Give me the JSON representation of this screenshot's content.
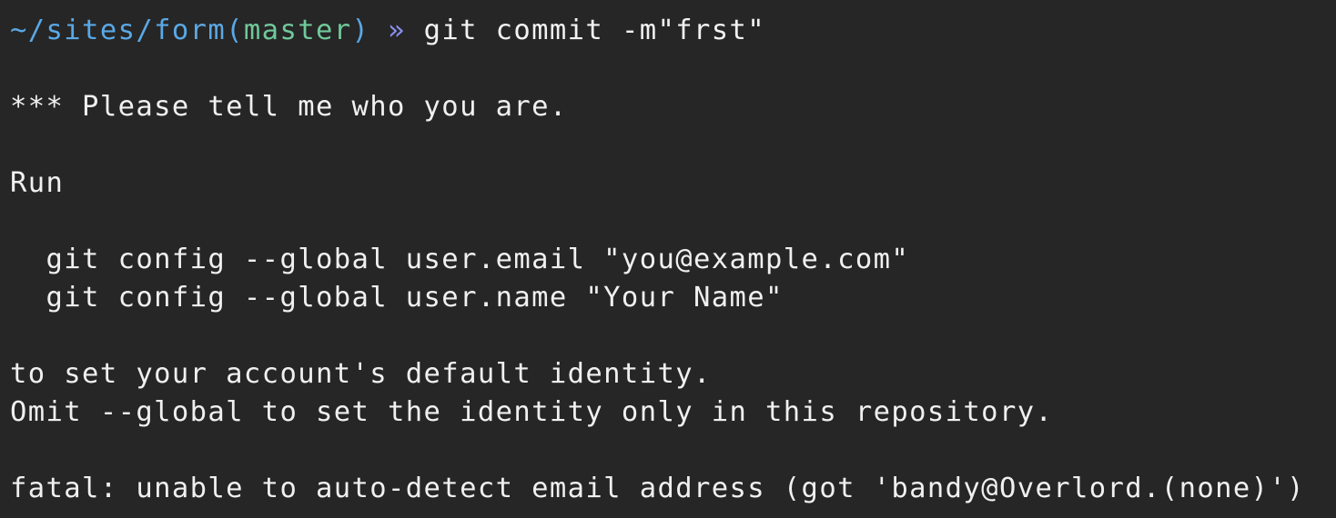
{
  "colors": {
    "background": "#262626",
    "text": "#f0f0f0",
    "path": "#5aa8e6",
    "branch": "#70c99a",
    "prompt_arrow": "#8a8ff0"
  },
  "prompt": {
    "path": "~/sites/form",
    "paren_open": "(",
    "branch": "master",
    "paren_close": ")",
    "arrow": "»",
    "command": "git commit -m\"frst\""
  },
  "output": [
    "",
    "*** Please tell me who you are.",
    "",
    "Run",
    "",
    "  git config --global user.email \"you@example.com\"",
    "  git config --global user.name \"Your Name\"",
    "",
    "to set your account's default identity.",
    "Omit --global to set the identity only in this repository.",
    "",
    "fatal: unable to auto-detect email address (got 'bandy@Overlord.(none)')"
  ]
}
